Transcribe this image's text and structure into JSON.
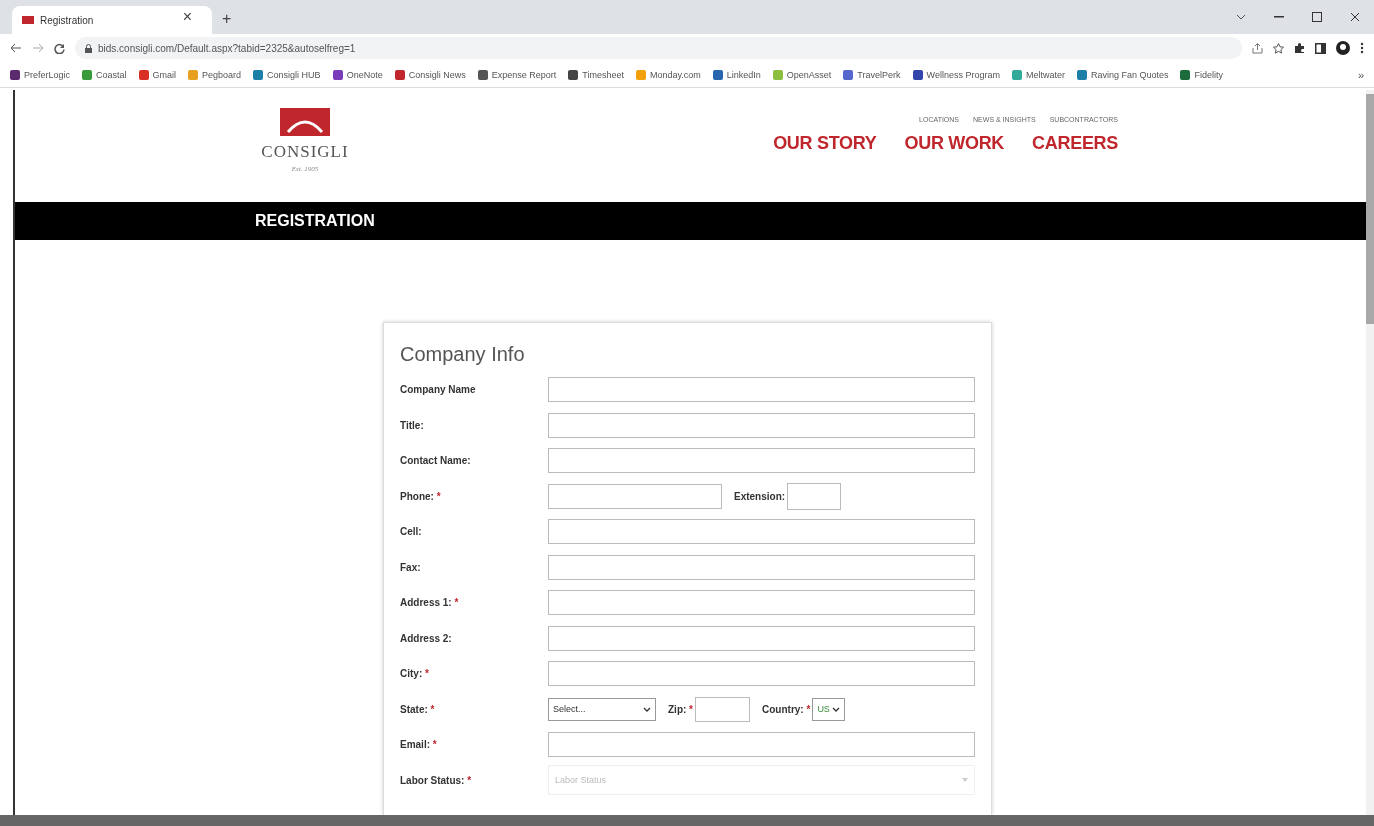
{
  "browser": {
    "tab": {
      "title": "Registration",
      "close": "×"
    },
    "new_tab": "+",
    "url": "bids.consigli.com/Default.aspx?tabid=2325&autoselfreg=1",
    "bookmarks": [
      {
        "label": "PreferLogic",
        "color": "#5b2a6e"
      },
      {
        "label": "Coastal",
        "color": "#3a9a3a"
      },
      {
        "label": "Gmail",
        "color": "#d93025"
      },
      {
        "label": "Pegboard",
        "color": "#e8a020"
      },
      {
        "label": "Consigli HUB",
        "color": "#1b7fa6"
      },
      {
        "label": "OneNote",
        "color": "#7a3cb8"
      },
      {
        "label": "Consigli News",
        "color": "#c0272d"
      },
      {
        "label": "Expense Report",
        "color": "#555555"
      },
      {
        "label": "Timesheet",
        "color": "#444444"
      },
      {
        "label": "Monday.com",
        "color": "#f2a10c"
      },
      {
        "label": "LinkedIn",
        "color": "#2a66b0"
      },
      {
        "label": "OpenAsset",
        "color": "#8cbf3f"
      },
      {
        "label": "TravelPerk",
        "color": "#5566cc"
      },
      {
        "label": "Wellness Program",
        "color": "#3344aa"
      },
      {
        "label": "Meltwater",
        "color": "#33aa99"
      },
      {
        "label": "Raving Fan Quotes",
        "color": "#1b7fa6"
      },
      {
        "label": "Fidelity",
        "color": "#1d6b3a"
      }
    ],
    "more": "»"
  },
  "site": {
    "logo": {
      "name": "CONSIGLI",
      "tagline": "Est. 1905"
    },
    "utility_nav": [
      "LOCATIONS",
      "NEWS & INSIGHTS",
      "SUBCONTRACTORS"
    ],
    "main_nav": [
      "OUR STORY",
      "OUR WORK",
      "CAREERS"
    ],
    "banner": "REGISTRATION"
  },
  "form": {
    "title": "Company Info",
    "fields": [
      {
        "kind": "text",
        "label": "Company Name"
      },
      {
        "kind": "text",
        "label": "Title:"
      },
      {
        "kind": "text",
        "label": "Contact Name:"
      },
      {
        "kind": "phone",
        "label": "Phone:",
        "asterisk": "*",
        "extension_label": "Extension:"
      },
      {
        "kind": "text",
        "label": "Cell:"
      },
      {
        "kind": "text",
        "label": "Fax:"
      },
      {
        "kind": "text",
        "label": "Address 1:",
        "asterisk": "*"
      },
      {
        "kind": "text",
        "label": "Address 2:"
      },
      {
        "kind": "text",
        "label": "City:",
        "asterisk": "*"
      },
      {
        "kind": "location",
        "label": "State:",
        "asterisk": "*",
        "state_value": "Select...",
        "zip_label": "Zip:",
        "zip_asterisk": "*",
        "country_label": "Country:",
        "country_asterisk": "*",
        "country_value": "US"
      },
      {
        "kind": "text",
        "label": "Email:",
        "asterisk": "*"
      },
      {
        "kind": "dropdown",
        "label": "Labor Status:",
        "asterisk": "*",
        "placeholder": "Labor Status"
      }
    ]
  }
}
